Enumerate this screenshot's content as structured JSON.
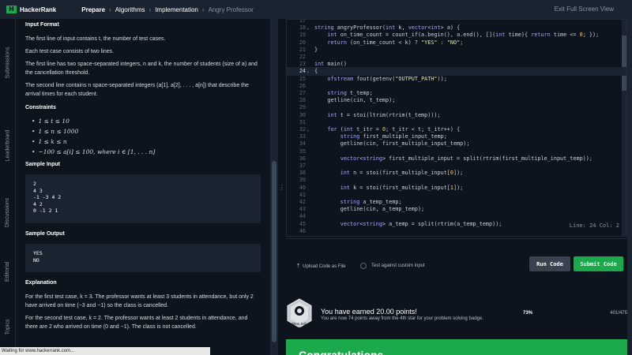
{
  "topbar": {
    "logo_mark": "H",
    "logo_text": "HackerRank",
    "breadcrumbs": [
      {
        "label": "Prepare"
      },
      {
        "label": "Algorithms"
      },
      {
        "label": "Implementation"
      },
      {
        "label": "Angry Professor"
      }
    ],
    "exit_fullscreen": "Exit Full Screen View"
  },
  "side_tabs": [
    "Submissions",
    "Leaderboard",
    "Discussions",
    "Editorial",
    "Topics"
  ],
  "problem": {
    "input_format_title": "Input Format",
    "input_lines": [
      "The first line of input contains t, the number of test cases.",
      "Each test case consists of two lines.",
      "The first line has two space-separated integers, n and k, the number of students (size of a) and the cancellation threshold.",
      "The second line contains n space-separated integers (a[1], a[2], . . . , a[n]) that describe the arrival times for each student."
    ],
    "constraints_title": "Constraints",
    "constraints": [
      "1 ≤ t ≤ 10",
      "1 ≤ n ≤ 1000",
      "1 ≤ k ≤ n",
      "−100 ≤ a[i] ≤ 100, where i ∈ [1, . . . n]"
    ],
    "sample_input_title": "Sample Input",
    "sample_input": "2\n4 3\n-1 -3 4 2\n4 2\n0 -1 2 1",
    "sample_output_title": "Sample Output",
    "sample_output": "YES\nNO",
    "explanation_title": "Explanation",
    "explanation": [
      "For the first test case, k = 3. The professor wants at least 3 students in attendance, but only 2 have arrived on time (−3 and −1) so the class is cancelled.",
      "For the second test case, k = 2. The professor wants at least 2 students in attendance, and there are 2 who arrived on time (0 and −1). The class is not cancelled."
    ]
  },
  "status_bar": "Waiting for www.hackerrank.com...",
  "divider_handle": "⋮",
  "editor": {
    "lines": [
      {
        "n": "17",
        "code": ""
      },
      {
        "n": "18",
        "fold": "v",
        "code": "string angryProfessor(int k, vector<int> a) {"
      },
      {
        "n": "19",
        "code": "    int on_time_count = count_if(a.begin(), a.end(), [](int time){ return time <= 0; });"
      },
      {
        "n": "20",
        "code": "    return (on_time_count < k) ? \"YES\" : \"NO\";"
      },
      {
        "n": "21",
        "code": "}"
      },
      {
        "n": "22",
        "code": ""
      },
      {
        "n": "23",
        "code": "int main()"
      },
      {
        "n": "24",
        "fold": "v",
        "code": "{",
        "active": true
      },
      {
        "n": "25",
        "code": "    ofstream fout(getenv(\"OUTPUT_PATH\"));"
      },
      {
        "n": "26",
        "code": ""
      },
      {
        "n": "27",
        "code": "    string t_temp;"
      },
      {
        "n": "28",
        "code": "    getline(cin, t_temp);"
      },
      {
        "n": "29",
        "code": ""
      },
      {
        "n": "30",
        "code": "    int t = stoi(ltrim(rtrim(t_temp)));"
      },
      {
        "n": "31",
        "code": ""
      },
      {
        "n": "32",
        "fold": "v",
        "code": "    for (int t_itr = 0; t_itr < t; t_itr++) {"
      },
      {
        "n": "33",
        "code": "        string first_multiple_input_temp;"
      },
      {
        "n": "34",
        "code": "        getline(cin, first_multiple_input_temp);"
      },
      {
        "n": "35",
        "code": ""
      },
      {
        "n": "36",
        "code": "        vector<string> first_multiple_input = split(rtrim(first_multiple_input_temp));"
      },
      {
        "n": "37",
        "code": ""
      },
      {
        "n": "38",
        "code": "        int n = stoi(first_multiple_input[0]);"
      },
      {
        "n": "39",
        "code": ""
      },
      {
        "n": "40",
        "code": "        int k = stoi(first_multiple_input[1]);"
      },
      {
        "n": "41",
        "code": ""
      },
      {
        "n": "42",
        "code": "        string a_temp_temp;"
      },
      {
        "n": "43",
        "code": "        getline(cin, a_temp_temp);"
      },
      {
        "n": "44",
        "code": ""
      },
      {
        "n": "45",
        "code": "        vector<string> a_temp = split(rtrim(a_temp_temp));"
      },
      {
        "n": "46",
        "code": ""
      }
    ],
    "cursor_position": "Line: 24 Col: 2"
  },
  "actions": {
    "upload_label": "Upload Code as File",
    "custom_input_label": "Test against custom input",
    "run_label": "Run Code",
    "submit_label": "Submit Code"
  },
  "points": {
    "badge_label": "Problem Solving",
    "badge_stars": "★★★",
    "title": "You have earned 20.00 points!",
    "subtitle": "You are now 74 points away from the 4th star for your problem solving badge.",
    "percent": "73%",
    "progress": "401/475"
  },
  "congrats": "Congratulations",
  "colors": {
    "accent": "#1ba94c",
    "bg": "#0e141e",
    "panel": "#1a2330"
  }
}
